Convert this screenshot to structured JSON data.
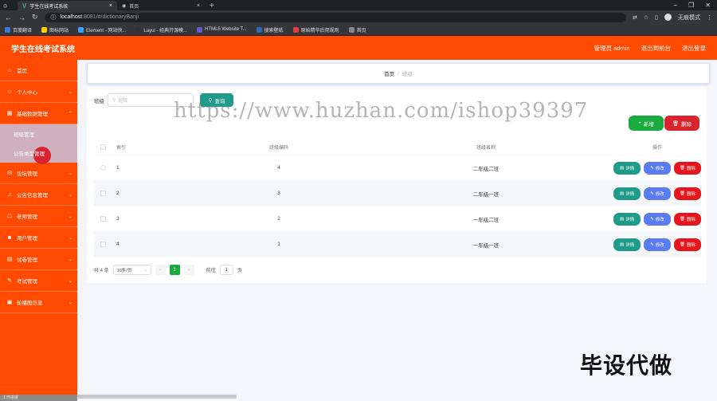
{
  "browser": {
    "tabs": [
      {
        "label": "学生在线考试系统",
        "active": true
      },
      {
        "label": "首页",
        "active": false
      }
    ],
    "new_tab": "+",
    "url_host": "localhost",
    "url_path": ":8081/#/dictionaryBanji",
    "profile_label": "无痕模式",
    "bookmarks": [
      "百度翻译",
      "图标网站",
      "Element - 网站快...",
      "Layui - 经典开源模...",
      "HTML5 Website T...",
      "搜索壁纸",
      "原始精华后用规则",
      "首页"
    ]
  },
  "header": {
    "title": "学生在线考试系统",
    "role_user": "管理员 admin",
    "back_to_front": "退出到前台",
    "logout": "退出登录"
  },
  "sidebar": {
    "items": [
      {
        "label": "首页",
        "icon": "home-icon"
      },
      {
        "label": "个人中心",
        "icon": "user-icon"
      },
      {
        "label": "基础数据管理",
        "icon": "grid-icon",
        "expanded": true
      },
      {
        "label": "论坛管理",
        "icon": "chat-icon"
      },
      {
        "label": "公告信息管理",
        "icon": "bell-icon"
      },
      {
        "label": "老师管理",
        "icon": "teacher-icon"
      },
      {
        "label": "用户管理",
        "icon": "users-icon"
      },
      {
        "label": "试卷管理",
        "icon": "paper-icon"
      },
      {
        "label": "考试管理",
        "icon": "exam-icon"
      },
      {
        "label": "轮播图信息",
        "icon": "image-icon"
      }
    ],
    "subitems": [
      "班级管理",
      "公告类型管理"
    ],
    "footer": "工作进度"
  },
  "breadcrumb": {
    "home": "首页",
    "sep": "/",
    "current": "班级"
  },
  "search": {
    "label": "班级",
    "placeholder": "班级",
    "button": "查询"
  },
  "actions": {
    "add": "新增",
    "delete": "删除"
  },
  "table": {
    "headers": {
      "index": "索引",
      "code": "班级编码",
      "name": "班级名称",
      "ops": "操作"
    },
    "rows": [
      {
        "index": "1",
        "code": "4",
        "name": "二年级二班"
      },
      {
        "index": "2",
        "code": "3",
        "name": "二年级一班"
      },
      {
        "index": "3",
        "code": "2",
        "name": "一年级二班"
      },
      {
        "index": "4",
        "code": "1",
        "name": "一年级一班"
      }
    ],
    "op_labels": {
      "detail": "详情",
      "edit": "修改",
      "delete": "删除"
    }
  },
  "pager": {
    "total": "共 4 条",
    "page_size": "10条/页",
    "current_page": "1",
    "goto_label": "前往",
    "goto_value": "1",
    "page_unit": "页"
  },
  "overlay": {
    "watermark": "https://www.huzhan.com/ishop39397",
    "corner_text": "毕设代做"
  },
  "colors": {
    "brand": "#ff4a00",
    "search_btn": "#1e9b8a",
    "add_btn": "#1aab3e",
    "del_btn": "#d9232f",
    "edit_btn": "#5a7cf0"
  }
}
